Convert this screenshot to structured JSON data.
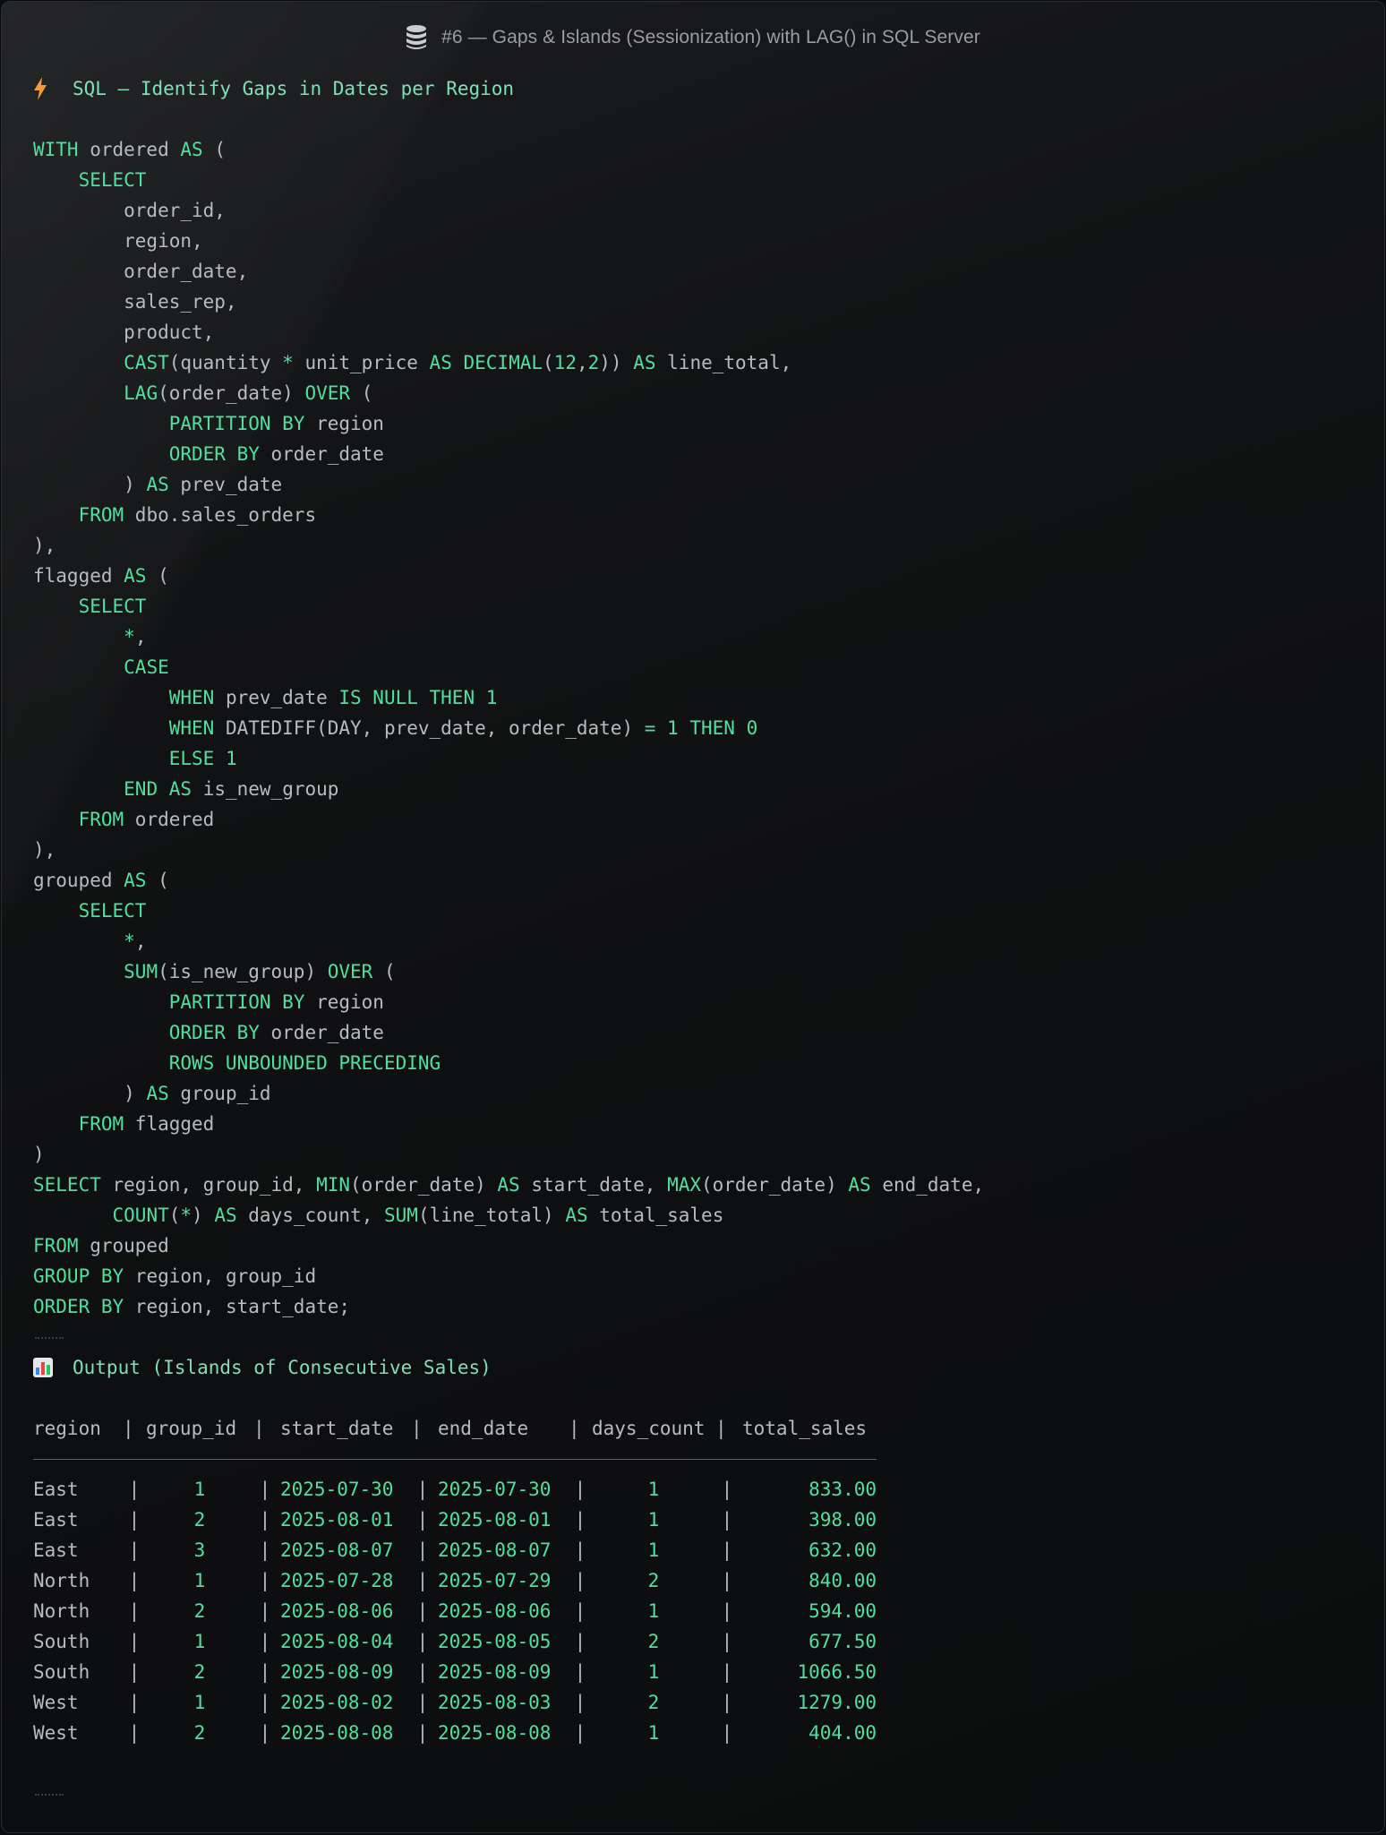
{
  "window": {
    "title": "#6 — Gaps & Islands (Sessionization) with LAG() in SQL Server",
    "title_icon": "database-icon"
  },
  "heading": {
    "icon": "lightning-icon",
    "text": "SQL — Identify Gaps in Dates per Region"
  },
  "code": {
    "language": "sql",
    "lines": [
      [
        [
          "kw",
          "WITH"
        ],
        [
          "id",
          " ordered "
        ],
        [
          "kw",
          "AS"
        ],
        [
          "id",
          " ("
        ]
      ],
      [
        [
          "id",
          "    "
        ],
        [
          "kw",
          "SELECT"
        ]
      ],
      [
        [
          "id",
          "        order_id,"
        ]
      ],
      [
        [
          "id",
          "        region,"
        ]
      ],
      [
        [
          "id",
          "        order_date,"
        ]
      ],
      [
        [
          "id",
          "        sales_rep,"
        ]
      ],
      [
        [
          "id",
          "        product,"
        ]
      ],
      [
        [
          "id",
          "        "
        ],
        [
          "kw",
          "CAST"
        ],
        [
          "id",
          "(quantity "
        ],
        [
          "op",
          "*"
        ],
        [
          "id",
          " unit_price "
        ],
        [
          "kw",
          "AS"
        ],
        [
          "id",
          " "
        ],
        [
          "kw",
          "DECIMAL"
        ],
        [
          "id",
          "("
        ],
        [
          "num",
          "12"
        ],
        [
          "id",
          ","
        ],
        [
          "num",
          "2"
        ],
        [
          "id",
          ")) "
        ],
        [
          "kw",
          "AS"
        ],
        [
          "id",
          " line_total,"
        ]
      ],
      [
        [
          "id",
          "        "
        ],
        [
          "kw",
          "LAG"
        ],
        [
          "id",
          "(order_date) "
        ],
        [
          "kw",
          "OVER"
        ],
        [
          "id",
          " ("
        ]
      ],
      [
        [
          "id",
          "            "
        ],
        [
          "kw",
          "PARTITION BY"
        ],
        [
          "id",
          " region"
        ]
      ],
      [
        [
          "id",
          "            "
        ],
        [
          "kw",
          "ORDER BY"
        ],
        [
          "id",
          " order_date"
        ]
      ],
      [
        [
          "id",
          "        ) "
        ],
        [
          "kw",
          "AS"
        ],
        [
          "id",
          " prev_date"
        ]
      ],
      [
        [
          "id",
          "    "
        ],
        [
          "kw",
          "FROM"
        ],
        [
          "id",
          " dbo.sales_orders"
        ]
      ],
      [
        [
          "id",
          "),"
        ]
      ],
      [
        [
          "id",
          "flagged "
        ],
        [
          "kw",
          "AS"
        ],
        [
          "id",
          " ("
        ]
      ],
      [
        [
          "id",
          "    "
        ],
        [
          "kw",
          "SELECT"
        ]
      ],
      [
        [
          "id",
          "        "
        ],
        [
          "op",
          "*"
        ],
        [
          "id",
          ","
        ]
      ],
      [
        [
          "id",
          "        "
        ],
        [
          "kw",
          "CASE"
        ]
      ],
      [
        [
          "id",
          "            "
        ],
        [
          "kw",
          "WHEN"
        ],
        [
          "id",
          " prev_date "
        ],
        [
          "kw",
          "IS NULL THEN"
        ],
        [
          "id",
          " "
        ],
        [
          "num",
          "1"
        ]
      ],
      [
        [
          "id",
          "            "
        ],
        [
          "kw",
          "WHEN"
        ],
        [
          "id",
          " DATEDIFF(DAY, prev_date, order_date) "
        ],
        [
          "op",
          "="
        ],
        [
          "id",
          " "
        ],
        [
          "num",
          "1"
        ],
        [
          "id",
          " "
        ],
        [
          "kw",
          "THEN"
        ],
        [
          "id",
          " "
        ],
        [
          "num",
          "0"
        ]
      ],
      [
        [
          "id",
          "            "
        ],
        [
          "kw",
          "ELSE"
        ],
        [
          "id",
          " "
        ],
        [
          "num",
          "1"
        ]
      ],
      [
        [
          "id",
          "        "
        ],
        [
          "kw",
          "END"
        ],
        [
          "id",
          " "
        ],
        [
          "kw",
          "AS"
        ],
        [
          "id",
          " is_new_group"
        ]
      ],
      [
        [
          "id",
          "    "
        ],
        [
          "kw",
          "FROM"
        ],
        [
          "id",
          " ordered"
        ]
      ],
      [
        [
          "id",
          "),"
        ]
      ],
      [
        [
          "id",
          "grouped "
        ],
        [
          "kw",
          "AS"
        ],
        [
          "id",
          " ("
        ]
      ],
      [
        [
          "id",
          "    "
        ],
        [
          "kw",
          "SELECT"
        ]
      ],
      [
        [
          "id",
          "        "
        ],
        [
          "op",
          "*"
        ],
        [
          "id",
          ","
        ]
      ],
      [
        [
          "id",
          "        "
        ],
        [
          "kw",
          "SUM"
        ],
        [
          "id",
          "(is_new_group) "
        ],
        [
          "kw",
          "OVER"
        ],
        [
          "id",
          " ("
        ]
      ],
      [
        [
          "id",
          "            "
        ],
        [
          "kw",
          "PARTITION BY"
        ],
        [
          "id",
          " region"
        ]
      ],
      [
        [
          "id",
          "            "
        ],
        [
          "kw",
          "ORDER BY"
        ],
        [
          "id",
          " order_date"
        ]
      ],
      [
        [
          "id",
          "            "
        ],
        [
          "kw",
          "ROWS UNBOUNDED PRECEDING"
        ]
      ],
      [
        [
          "id",
          "        ) "
        ],
        [
          "kw",
          "AS"
        ],
        [
          "id",
          " group_id"
        ]
      ],
      [
        [
          "id",
          "    "
        ],
        [
          "kw",
          "FROM"
        ],
        [
          "id",
          " flagged"
        ]
      ],
      [
        [
          "id",
          ")"
        ]
      ],
      [
        [
          "kw",
          "SELECT"
        ],
        [
          "id",
          " region, group_id, "
        ],
        [
          "kw",
          "MIN"
        ],
        [
          "id",
          "(order_date) "
        ],
        [
          "kw",
          "AS"
        ],
        [
          "id",
          " start_date, "
        ],
        [
          "kw",
          "MAX"
        ],
        [
          "id",
          "(order_date) "
        ],
        [
          "kw",
          "AS"
        ],
        [
          "id",
          " end_date,"
        ]
      ],
      [
        [
          "id",
          "       "
        ],
        [
          "kw",
          "COUNT"
        ],
        [
          "id",
          "("
        ],
        [
          "op",
          "*"
        ],
        [
          "id",
          ") "
        ],
        [
          "kw",
          "AS"
        ],
        [
          "id",
          " days_count, "
        ],
        [
          "kw",
          "SUM"
        ],
        [
          "id",
          "(line_total) "
        ],
        [
          "kw",
          "AS"
        ],
        [
          "id",
          " total_sales"
        ]
      ],
      [
        [
          "kw",
          "FROM"
        ],
        [
          "id",
          " grouped"
        ]
      ],
      [
        [
          "kw",
          "GROUP BY"
        ],
        [
          "id",
          " region, group_id"
        ]
      ],
      [
        [
          "kw",
          "ORDER BY"
        ],
        [
          "id",
          " region, start_date;"
        ]
      ]
    ]
  },
  "output": {
    "icon": "bar-chart-icon",
    "heading": "Output (Islands of Consecutive Sales)",
    "columns": [
      "region",
      "group_id",
      "start_date",
      "end_date",
      "days_count",
      "total_sales"
    ],
    "rows": [
      [
        "East",
        "1",
        "2025-07-30",
        "2025-07-30",
        "1",
        "833.00"
      ],
      [
        "East",
        "2",
        "2025-08-01",
        "2025-08-01",
        "1",
        "398.00"
      ],
      [
        "East",
        "3",
        "2025-08-07",
        "2025-08-07",
        "1",
        "632.00"
      ],
      [
        "North",
        "1",
        "2025-07-28",
        "2025-07-29",
        "2",
        "840.00"
      ],
      [
        "North",
        "2",
        "2025-08-06",
        "2025-08-06",
        "1",
        "594.00"
      ],
      [
        "South",
        "1",
        "2025-08-04",
        "2025-08-05",
        "2",
        "677.50"
      ],
      [
        "South",
        "2",
        "2025-08-09",
        "2025-08-09",
        "1",
        "1066.50"
      ],
      [
        "West",
        "1",
        "2025-08-02",
        "2025-08-03",
        "2",
        "1279.00"
      ],
      [
        "West",
        "2",
        "2025-08-08",
        "2025-08-08",
        "1",
        "404.00"
      ]
    ]
  },
  "colors": {
    "background": "#0e0f10",
    "keyword": "#4fe0a0",
    "identifier": "#b6bcc4",
    "heading": "#7ee0b8",
    "title": "#9a9da1"
  }
}
